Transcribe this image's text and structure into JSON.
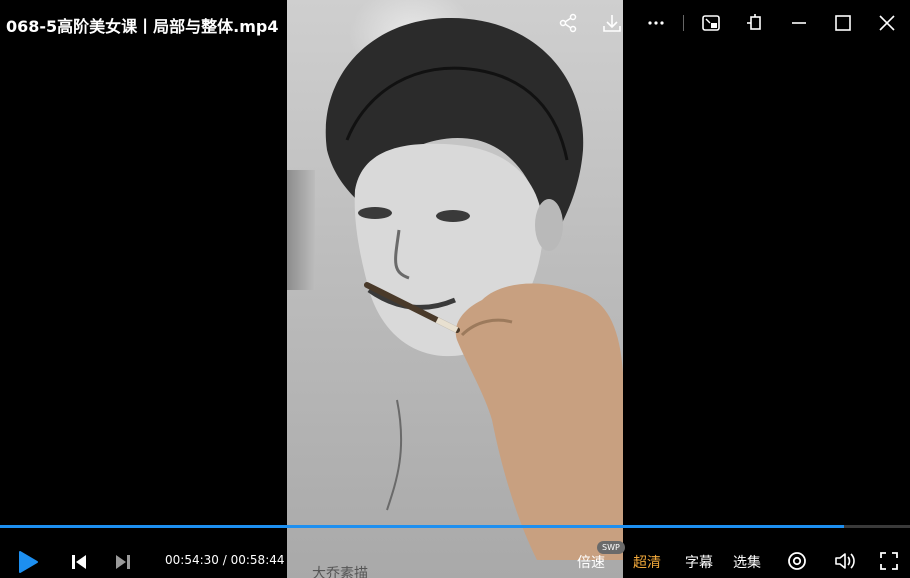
{
  "window": {
    "title": "068-5高阶美女课丨局部与整体.mp4"
  },
  "video": {
    "watermark": "大乔素描"
  },
  "toolbar": {
    "icons": [
      "share-icon",
      "download-icon",
      "more-icon",
      "mini-mode-icon",
      "pin-icon",
      "minimize-icon",
      "maximize-icon",
      "close-icon"
    ]
  },
  "player": {
    "current_time": "00:54:30",
    "separator": "/",
    "duration": "00:58:44",
    "progress_fraction": 0.928,
    "speed_label": "倍速",
    "speed_badge": "SWP",
    "quality_label": "超清",
    "subtitle_label": "字幕",
    "episodes_label": "选集",
    "accent_color": "#1d8ff0",
    "active_color": "#f2a93b"
  }
}
